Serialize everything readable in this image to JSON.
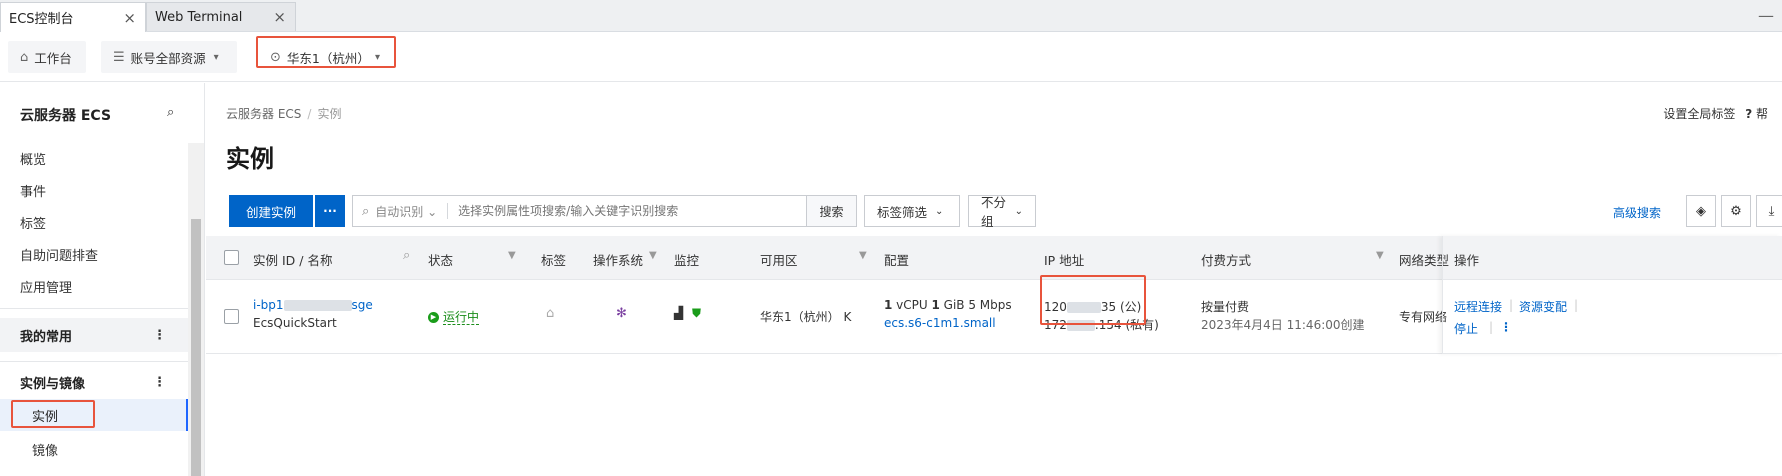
{
  "browser_tabs": [
    {
      "label": "ECS控制台",
      "active": true
    },
    {
      "label": "Web Terminal",
      "active": false
    }
  ],
  "topbar": {
    "workbench": "工作台",
    "account_resources": "账号全部资源",
    "region": "华东1（杭州）"
  },
  "sidebar": {
    "title": "云服务器 ECS",
    "items": [
      "概览",
      "事件",
      "标签",
      "自助问题排查",
      "应用管理"
    ],
    "favorites_group": "我的常用",
    "instance_group": "实例与镜像",
    "sub_items": [
      "实例",
      "镜像"
    ]
  },
  "main": {
    "breadcrumb": {
      "root": "云服务器 ECS",
      "sep": "/",
      "current": "实例"
    },
    "global_tags": "设置全局标签",
    "help": "帮",
    "title": "实例",
    "create_button": "创建实例",
    "more_button": "···",
    "search_mode": "自动识别",
    "search_placeholder": "选择实例属性项搜索/输入关键字识别搜索",
    "search_button": "搜索",
    "tag_filter": "标签筛选",
    "group": "不分组",
    "advanced_search": "高级搜索"
  },
  "table": {
    "headers": {
      "id": "实例 ID / 名称",
      "status": "状态",
      "tags": "标签",
      "os": "操作系统",
      "monitor": "监控",
      "zone": "可用区",
      "config": "配置",
      "ip": "IP 地址",
      "billing": "付费方式",
      "network": "网络类型",
      "ops": "操作"
    },
    "row": {
      "id_prefix": "i-bp1",
      "id_suffix": "sge",
      "name": "EcsQuickStart",
      "status": "运行中",
      "zone": "华东1（杭州） K",
      "config_line1_cpu": "1",
      "config_line1_cpu_unit": " vCPU  ",
      "config_line1_mem": "1",
      "config_line1_rest": " GiB 5 Mbps",
      "config_spec": "ecs.s6-c1m1.small",
      "ip_public_prefix": "120",
      "ip_public_suffix": "35 (公)",
      "ip_private_prefix": "172",
      "ip_private_suffix": ".154 (私有)",
      "billing": "按量付费",
      "created": "2023年4月4日 11:46:00创建",
      "network": "专有网络",
      "op_remote": "远程连接",
      "op_change": "资源变配",
      "op_stop": "停止"
    }
  },
  "colors": {
    "primary": "#0064c8",
    "highlight_box": "#e8543c",
    "running": "#1a8d1a"
  }
}
